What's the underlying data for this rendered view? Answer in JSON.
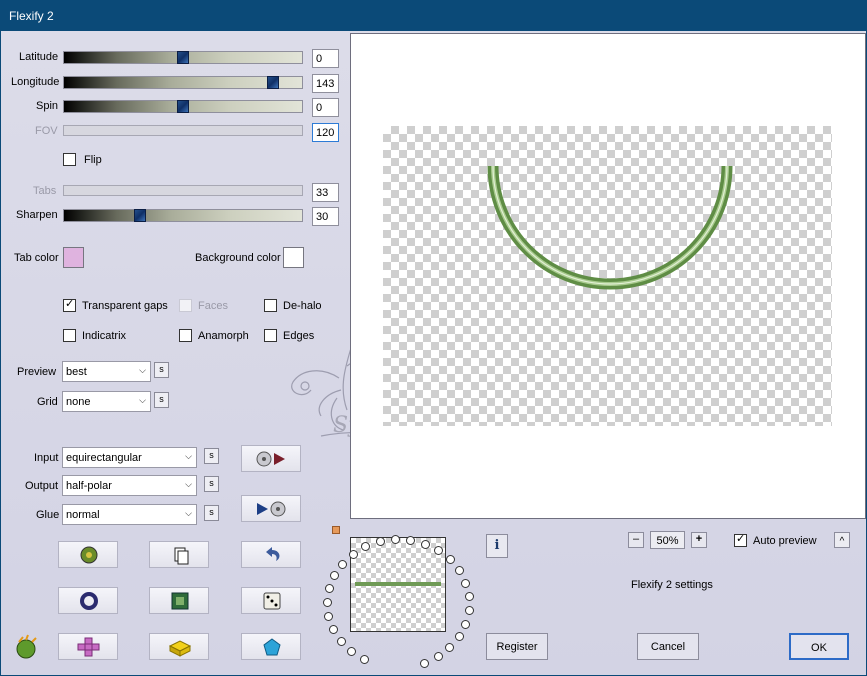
{
  "window": {
    "title": "Flexify 2"
  },
  "sliders": [
    {
      "name": "latitude",
      "label": "Latitude",
      "value": "0",
      "level": 0.5,
      "enabled": true
    },
    {
      "name": "longitude",
      "label": "Longitude",
      "value": "143",
      "level": 0.9,
      "enabled": true
    },
    {
      "name": "spin",
      "label": "Spin",
      "value": "0",
      "level": 0.5,
      "enabled": true
    },
    {
      "name": "fov",
      "label": "FOV",
      "value": "120",
      "enabled": false
    },
    {
      "name": "tabs",
      "label": "Tabs",
      "value": "33",
      "enabled": false
    },
    {
      "name": "sharpen",
      "label": "Sharpen",
      "value": "30",
      "level": 0.31,
      "enabled": true
    }
  ],
  "flip": {
    "label": "Flip",
    "checked": false
  },
  "colors": {
    "tab_color_label": "Tab color",
    "tab_color": "#dfb3df",
    "background_color_label": "Background color",
    "background_color": "#ffffff"
  },
  "options": {
    "transparent_gaps": {
      "label": "Transparent gaps",
      "checked": true
    },
    "faces": {
      "label": "Faces",
      "checked": false,
      "enabled": false
    },
    "de_halo": {
      "label": "De-halo",
      "checked": false
    },
    "indicatrix": {
      "label": "Indicatrix",
      "checked": false
    },
    "anamorph": {
      "label": "Anamorph",
      "checked": false
    },
    "edges": {
      "label": "Edges",
      "checked": false
    }
  },
  "preview_quality": {
    "label": "Preview",
    "value": "best"
  },
  "grid": {
    "label": "Grid",
    "value": "none"
  },
  "projection": {
    "input_label": "Input",
    "input": "equirectangular",
    "output_label": "Output",
    "output": "half-polar",
    "glue_label": "Glue",
    "glue": "normal"
  },
  "small_button_glyph": "s",
  "watermark": {
    "text": "Sylviane"
  },
  "zoom": {
    "minus": "–",
    "value": "50%",
    "plus": "+"
  },
  "auto_preview": {
    "label": "Auto preview",
    "checked": true
  },
  "collapse_glyph": "^",
  "info_glyph": "i",
  "settings_title": "Flexify 2 settings",
  "buttons": {
    "register": "Register",
    "cancel": "Cancel",
    "ok": "OK"
  },
  "accent_colors": {
    "title_bar": "#0b4a78",
    "shape_green": "#6f9a55",
    "thumb_blue": "#1c3f7a"
  }
}
